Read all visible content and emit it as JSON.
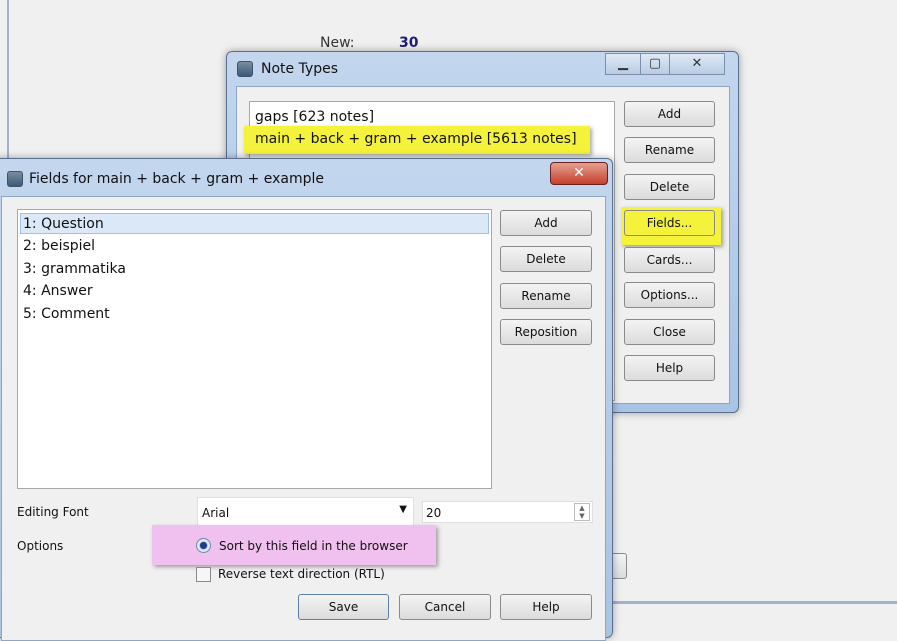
{
  "background": {
    "new_label": "New:",
    "new_value": "30"
  },
  "note_types": {
    "title": "Note Types",
    "items": [
      "gaps [623 notes]",
      "main + back + gram + example [5613 notes]"
    ],
    "buttons": [
      "Add",
      "Rename",
      "Delete",
      "Fields...",
      "Cards...",
      "Options...",
      "Close",
      "Help"
    ]
  },
  "fields": {
    "title": "Fields for main + back + gram + example",
    "items": [
      "1: Question",
      "2: beispiel",
      "3: grammatika",
      "4: Answer",
      "5: Comment"
    ],
    "buttons": [
      "Add",
      "Delete",
      "Rename",
      "Reposition"
    ],
    "editing_font_label": "Editing Font",
    "font_value": "Arial",
    "size_value": "20",
    "options_label": "Options",
    "sort_option": "Sort by this field in the browser",
    "sort_checked": true,
    "rtl_option": "Reverse text direction (RTL)",
    "rtl_checked": false,
    "save": "Save",
    "cancel": "Cancel",
    "help": "Help"
  },
  "colors": {
    "highlight_yellow": "#f4f23a",
    "highlight_pink": "#f0c0ee",
    "selection": "#dbe8f8"
  }
}
